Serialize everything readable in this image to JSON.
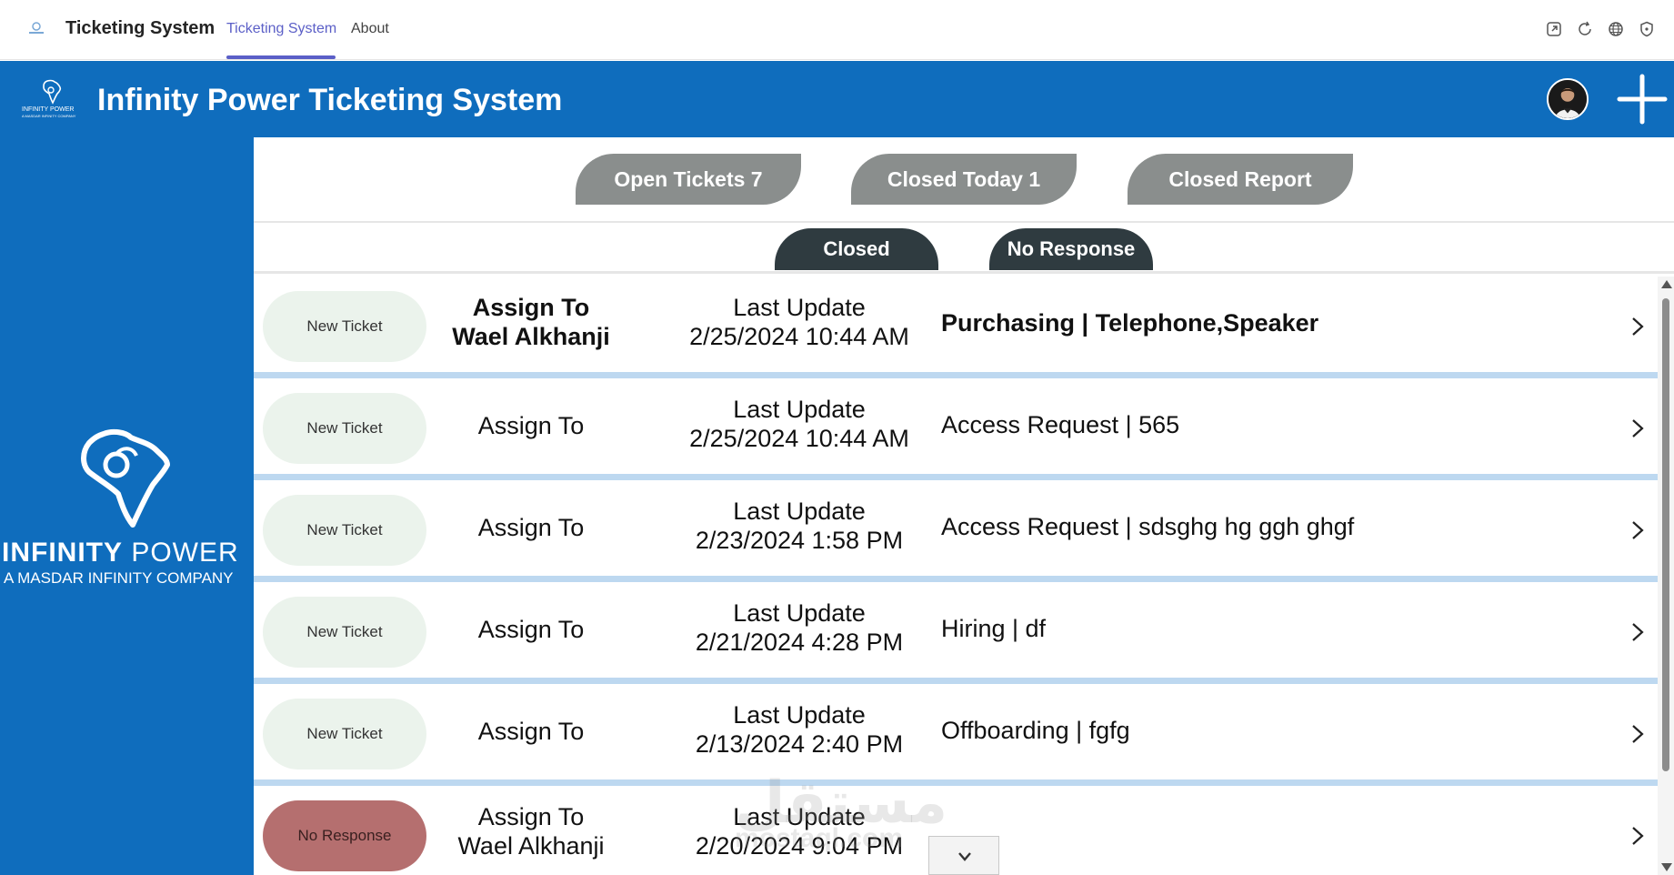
{
  "top_bar": {
    "app_title": "Ticketing System",
    "tabs": [
      {
        "label": "Ticketing System",
        "active": true
      },
      {
        "label": "About",
        "active": false
      }
    ],
    "tool_icons": [
      "popout-icon",
      "refresh-icon",
      "globe-icon",
      "shield-icon"
    ]
  },
  "header": {
    "logo_line1": "INFINITY POWER",
    "logo_line2": "A MASDAR INFINITY COMPANY",
    "title": "Infinity Power Ticketing System",
    "add_icon": "plus-icon",
    "accent_color": "#0f6dbd"
  },
  "sidebar": {
    "brand_bold": "INFINITY",
    "brand_light": " POWER",
    "brand_sub": "A MASDAR INFINITY COMPANY"
  },
  "filters": {
    "open_tickets": "Open Tickets 7",
    "closed_today": "Closed Today 1",
    "closed_report": "Closed Report",
    "closed": "Closed",
    "no_response": "No Response"
  },
  "tickets": [
    {
      "status": "New Ticket",
      "assign_label": "Assign To",
      "assignee": "Wael Alkhanji",
      "update_label": "Last Update",
      "updated": "2/25/2024 10:44 AM",
      "subject": "Purchasing | Telephone,Speaker",
      "bold": true
    },
    {
      "status": "New Ticket",
      "assign_label": "Assign To",
      "assignee": "",
      "update_label": "Last Update",
      "updated": "2/25/2024 10:44 AM",
      "subject": "Access Request | 565",
      "bold": false
    },
    {
      "status": "New Ticket",
      "assign_label": "Assign To",
      "assignee": "",
      "update_label": "Last Update",
      "updated": "2/23/2024 1:58 PM",
      "subject": "Access Request | sdsghg hg ggh ghgf",
      "bold": false
    },
    {
      "status": "New Ticket",
      "assign_label": "Assign To",
      "assignee": "",
      "update_label": "Last Update",
      "updated": "2/21/2024 4:28 PM",
      "subject": "Hiring | df",
      "bold": false
    },
    {
      "status": "New Ticket",
      "assign_label": "Assign To",
      "assignee": "",
      "update_label": "Last Update",
      "updated": "2/13/2024 2:40 PM",
      "subject": "Offboarding | fgfg",
      "bold": false
    },
    {
      "status": "No Response",
      "assign_label": "Assign To",
      "assignee": "Wael Alkhanji",
      "update_label": "Last Update",
      "updated": "2/20/2024 9:04 PM",
      "subject": "",
      "bold": false
    }
  ],
  "watermark": {
    "line1": "مستقل",
    "line2": "mostaql.com"
  }
}
